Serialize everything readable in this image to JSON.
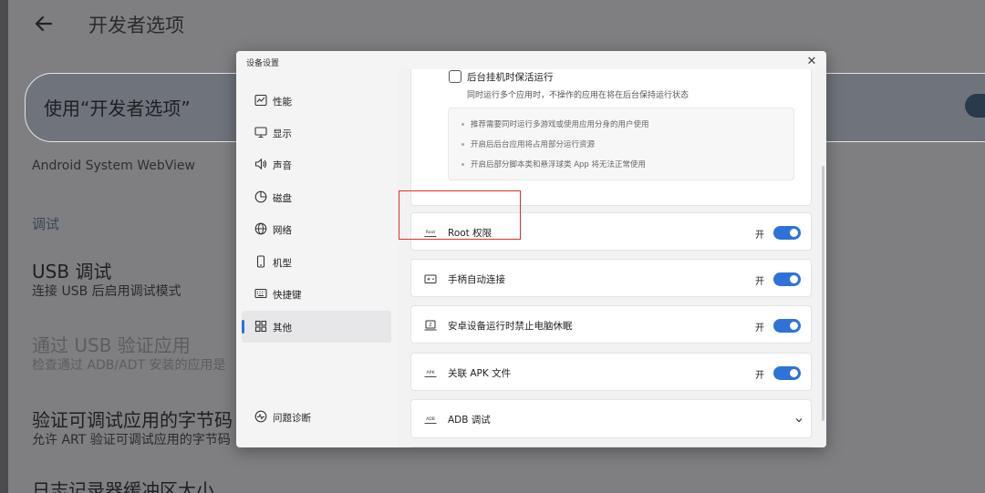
{
  "background": {
    "title": "开发者选项",
    "use_card_label": "使用“开发者选项”",
    "webview": "Android System WebView",
    "section_debug": "调试",
    "usb_debug_title": "USB 调试",
    "usb_debug_sub": "连接 USB 后启用调试模式",
    "verify_usb_title": "通过 USB 验证应用",
    "verify_usb_sub": "检查通过 ADB/ADT 安装的应用是",
    "verify_bytecode_title": "验证可调试应用的字节码",
    "verify_bytecode_sub": "允许 ART 验证可调试应用的字节码",
    "logger_title": "日志记录器缓冲区大小"
  },
  "dialog": {
    "title": "设备设置",
    "close": "✕",
    "nav": [
      {
        "label": "性能",
        "icon": "performance-icon"
      },
      {
        "label": "显示",
        "icon": "display-icon"
      },
      {
        "label": "声音",
        "icon": "sound-icon"
      },
      {
        "label": "磁盘",
        "icon": "disk-icon"
      },
      {
        "label": "网络",
        "icon": "network-icon"
      },
      {
        "label": "机型",
        "icon": "phone-icon"
      },
      {
        "label": "快捷键",
        "icon": "keyboard-icon"
      },
      {
        "label": "其他",
        "icon": "grid-icon",
        "active": true
      }
    ],
    "diagnose": "问题诊断",
    "keepalive": {
      "title": "后台挂机时保活运行",
      "desc": "同时运行多个应用时，不操作的应用在将在后台保持运行状态",
      "tips": [
        "推荐需要同时运行多游戏或使用应用分身的用户使用",
        "开启后后台应用将占用部分运行资源",
        "开启后部分脚本类和悬浮球类 App 将无法正常使用"
      ]
    },
    "settings": [
      {
        "label": "Root 权限",
        "state": "开",
        "icon": "root-icon"
      },
      {
        "label": "手柄自动连接",
        "state": "开",
        "icon": "gamepad-icon"
      },
      {
        "label": "安卓设备运行时禁止电脑休眠",
        "state": "开",
        "icon": "sleep-icon"
      },
      {
        "label": "关联 APK 文件",
        "state": "开",
        "icon": "apk-icon"
      }
    ],
    "adb": {
      "label": "ADB 调试",
      "icon": "adb-icon"
    },
    "icon_text": {
      "root": "Root",
      "apk": "APK",
      "adb": "ADB",
      "sleep": "Z"
    }
  },
  "colors": {
    "accent": "#2f73d8",
    "highlight": "#e0302e"
  }
}
